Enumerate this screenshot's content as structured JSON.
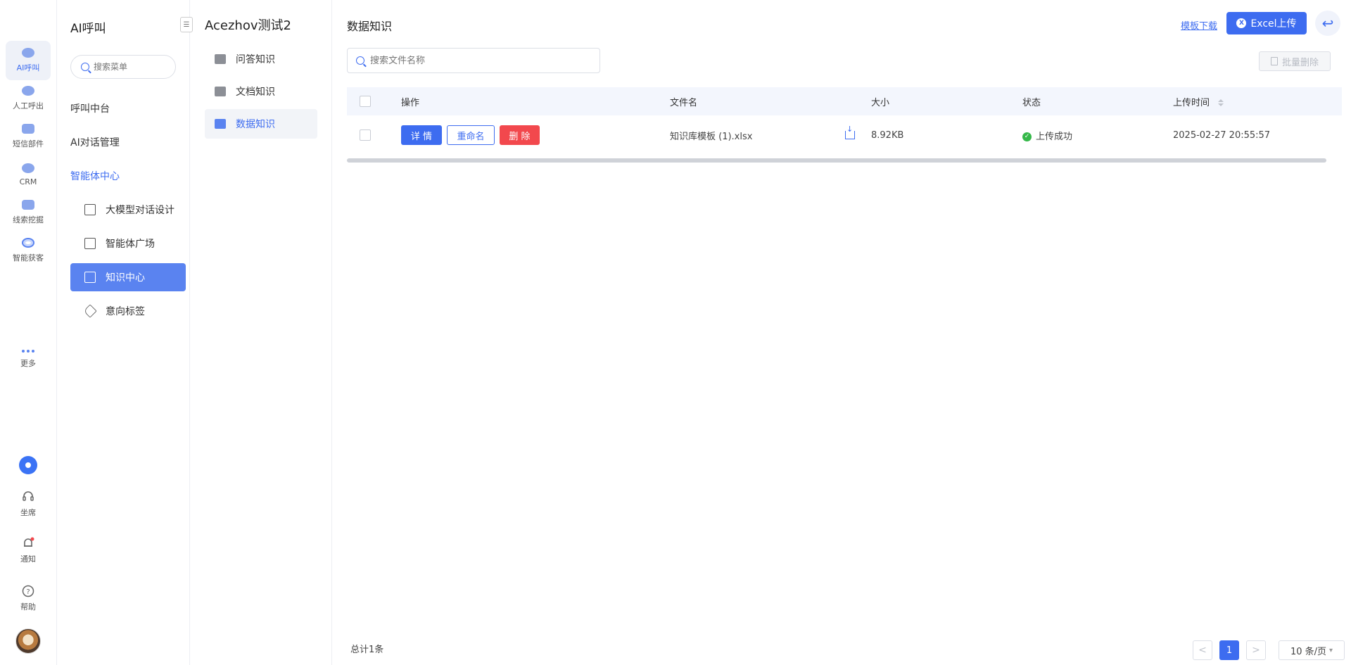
{
  "rail": {
    "items": [
      {
        "label": "AI呼叫",
        "icon": "robot-icon"
      },
      {
        "label": "人工呼出",
        "icon": "phone-icon"
      },
      {
        "label": "短信部件",
        "icon": "message-icon"
      },
      {
        "label": "CRM",
        "icon": "crm-icon"
      },
      {
        "label": "线索挖掘",
        "icon": "document-icon"
      },
      {
        "label": "智能获客",
        "icon": "target-icon"
      },
      {
        "label": "更多",
        "icon": "more-dots-icon"
      }
    ],
    "bottom": [
      {
        "label": "坐席",
        "icon": "headset-icon"
      },
      {
        "label": "通知",
        "icon": "bell-icon"
      },
      {
        "label": "帮助",
        "icon": "help-icon"
      }
    ]
  },
  "submenu": {
    "title": "AI呼叫",
    "search_placeholder": "搜索菜单",
    "groups": [
      "呼叫中台",
      "AI对话管理",
      "智能体中心"
    ],
    "items": [
      {
        "label": "大模型对话设计"
      },
      {
        "label": "智能体广场"
      },
      {
        "label": "知识中心"
      },
      {
        "label": "意向标签"
      }
    ]
  },
  "kb": {
    "title": "Acezhov测试2",
    "items": [
      {
        "label": "问答知识"
      },
      {
        "label": "文档知识"
      },
      {
        "label": "数据知识"
      }
    ]
  },
  "main": {
    "title": "数据知识",
    "template_download": "模板下载",
    "excel_upload": "Excel上传",
    "search_placeholder": "搜索文件名称",
    "batch_delete": "批量删除",
    "columns": {
      "action": "操作",
      "filename": "文件名",
      "size": "大小",
      "status": "状态",
      "upload_time": "上传时间"
    },
    "rows": [
      {
        "detail": "详 情",
        "rename": "重命名",
        "delete": "删 除",
        "filename": "知识库模板 (1).xlsx",
        "size": "8.92KB",
        "status": "上传成功",
        "upload_time": "2025-02-27 20:55:57"
      }
    ],
    "total": "总计1条",
    "pager": {
      "prev": "<",
      "current": "1",
      "next": ">",
      "page_size": "10 条/页"
    }
  },
  "colors": {
    "accent": "#3d6cf0",
    "danger": "#f2484d",
    "success": "#35b849"
  }
}
